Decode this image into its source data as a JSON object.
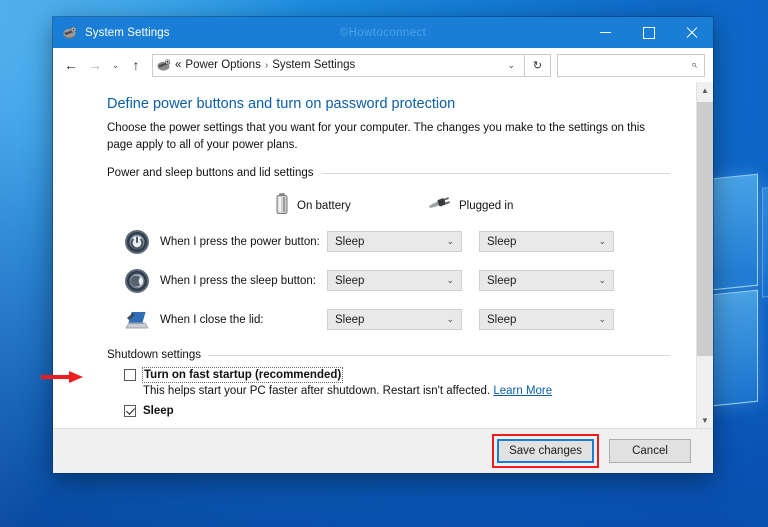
{
  "window": {
    "title": "System Settings",
    "watermark": "©Howtoconnect",
    "icon": "power-options-icon",
    "controls": {
      "minimize": "Minimize",
      "maximize": "Maximize",
      "close": "Close"
    }
  },
  "navbar": {
    "back": "←",
    "forward": "→",
    "recent": "⌄",
    "up": "↑",
    "breadcrumb": {
      "prefix": "«",
      "items": [
        "Power Options",
        "System Settings"
      ],
      "separator": "›"
    },
    "dropdown_chevron": "⌄",
    "refresh": "↻",
    "search_placeholder": "",
    "search_value": "",
    "search_icon": "search-icon"
  },
  "content": {
    "heading": "Define power buttons and turn on password protection",
    "description": "Choose the power settings that you want for your computer. The changes you make to the settings on this page apply to all of your power plans.",
    "group_title": "Power and sleep buttons and lid settings",
    "columns": [
      {
        "label": "On battery",
        "icon": "battery-icon"
      },
      {
        "label": "Plugged in",
        "icon": "power-plug-icon"
      }
    ],
    "rows": [
      {
        "icon": "power-button-icon",
        "label": "When I press the power button:",
        "on_battery": "Sleep",
        "plugged_in": "Sleep"
      },
      {
        "icon": "sleep-button-icon",
        "label": "When I press the sleep button:",
        "on_battery": "Sleep",
        "plugged_in": "Sleep"
      },
      {
        "icon": "laptop-lid-icon",
        "label": "When I close the lid:",
        "on_battery": "Sleep",
        "plugged_in": "Sleep"
      }
    ],
    "shutdown": {
      "group_title": "Shutdown settings",
      "fast_startup": {
        "label": "Turn on fast startup (recommended)",
        "checked": false,
        "description": "This helps start your PC faster after shutdown. Restart isn't affected.",
        "link": "Learn More"
      },
      "sleep": {
        "label": "Sleep",
        "checked": true
      }
    }
  },
  "footer": {
    "save": "Save changes",
    "cancel": "Cancel"
  },
  "colors": {
    "titlebar": "#1a7ed6",
    "heading": "#0a5fa8",
    "link": "#0a5fa8",
    "annotation": "#ee1c1c",
    "focus": "#1a7ed6"
  }
}
